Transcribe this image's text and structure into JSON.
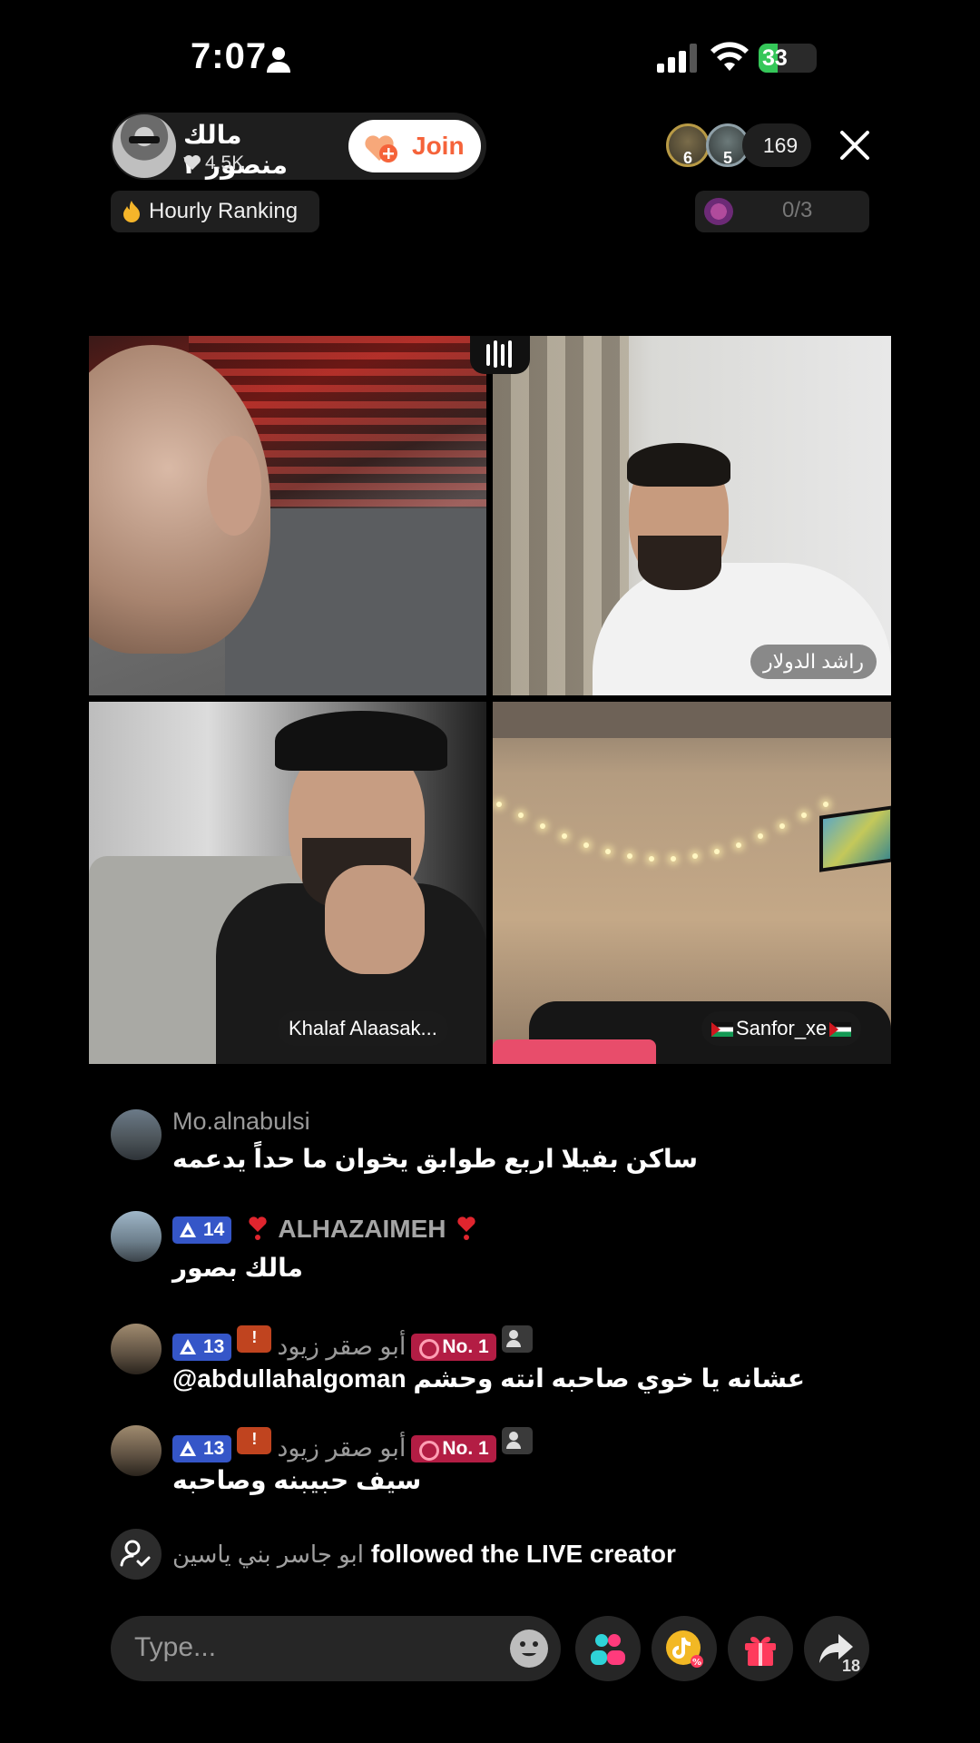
{
  "status_bar": {
    "time": "7:07",
    "battery": "33",
    "battery_level": 0.33
  },
  "host": {
    "name": "مالك منصور ٢",
    "likes": "4.5K",
    "join_label": "Join"
  },
  "viewers": {
    "badges": [
      "6",
      "5"
    ],
    "count": "169"
  },
  "hourly_ranking": "Hourly Ranking",
  "gift_goal": {
    "progress": "0/3"
  },
  "guests": [
    {
      "label": ""
    },
    {
      "label": "راشد الدولار"
    },
    {
      "label": "Khalaf Alaasak..."
    },
    {
      "label": "Sanfor_xe"
    }
  ],
  "comments": [
    {
      "user": "Mo.alnabulsi",
      "message": "ساكن بفيلا اربع طوابق يخوان ما حداً يدعمه"
    },
    {
      "level": "14",
      "user": "ALHAZAIMEH",
      "message": "مالك بصور"
    },
    {
      "level": "13",
      "user": "أبو صقر زيود",
      "rank": "No. 1",
      "message": "@abdullahalgoman عشانه يا خوي صاحبه انته وحشم"
    },
    {
      "level": "13",
      "user": "أبو صقر زيود",
      "rank": "No. 1",
      "message": "سيف حبيبنه وصاحبه"
    }
  ],
  "follow_event": {
    "user": "ابو جاسر بني ياسين",
    "text": "followed the LIVE creator"
  },
  "bottom_bar": {
    "placeholder": "Type...",
    "share_count": "18"
  },
  "colors": {
    "join_text": "#f5633a",
    "level_badge": "#3556c8",
    "rank_badge": "#b31d44",
    "battery": "#35c759",
    "gift": "#e83a5a"
  }
}
